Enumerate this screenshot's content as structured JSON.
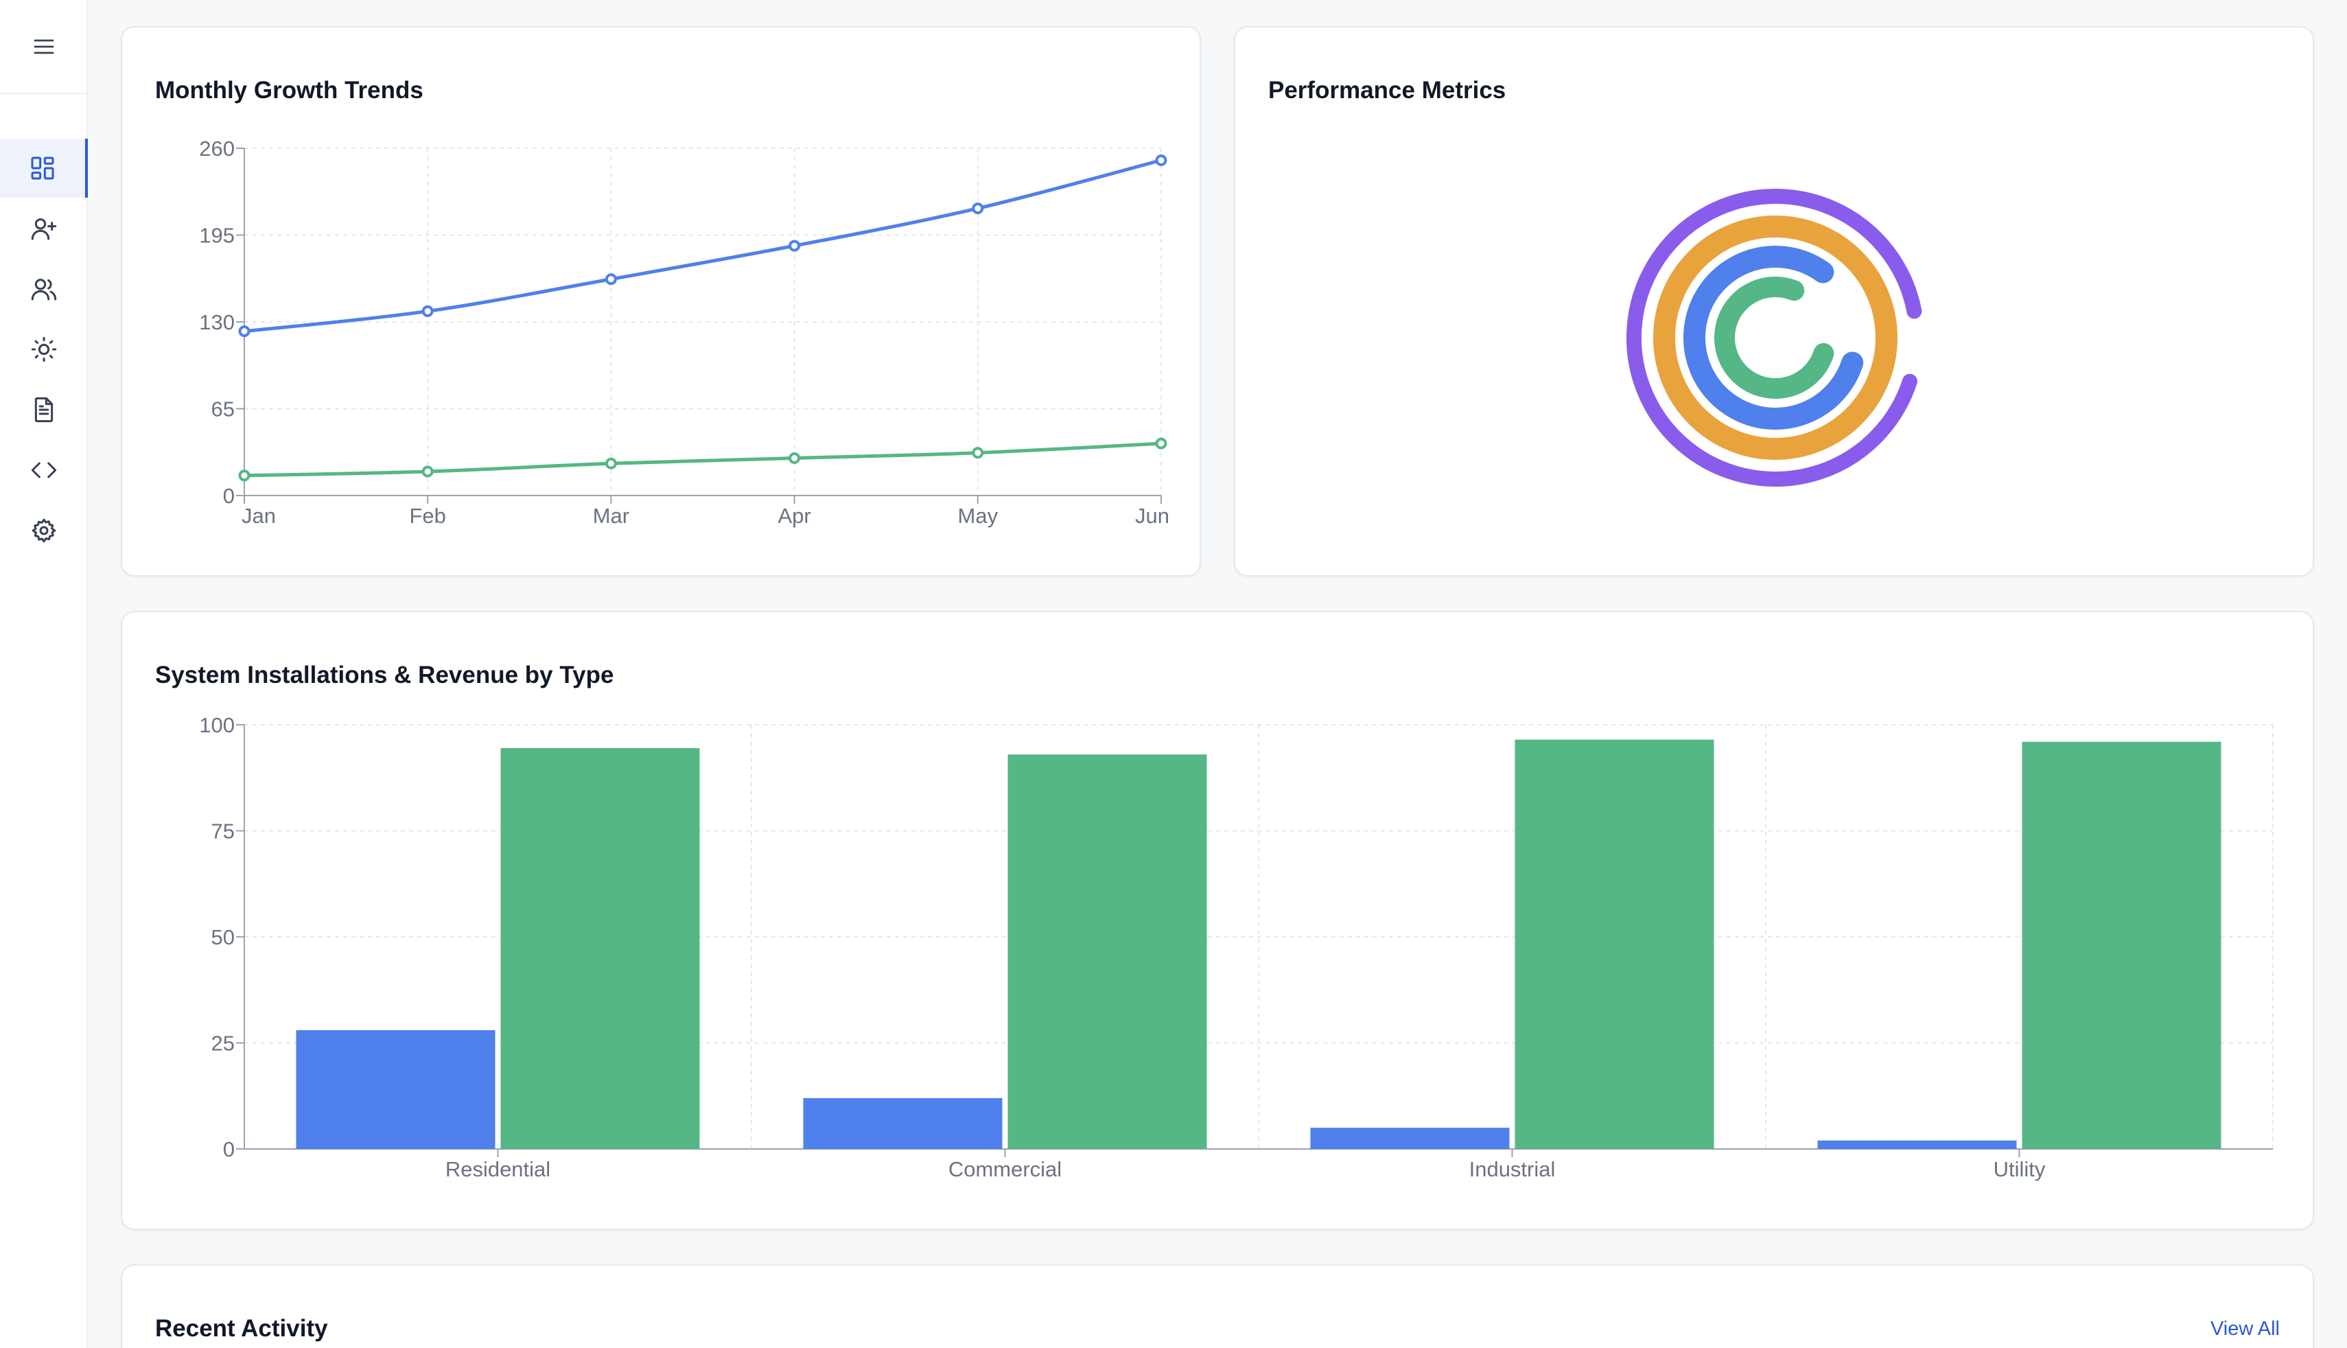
{
  "sidebar": {
    "menu_icon": "hamburger-icon",
    "items": [
      {
        "name": "dashboard",
        "icon": "dashboard-grid-icon",
        "active": true
      },
      {
        "name": "add-user",
        "icon": "user-plus-icon",
        "active": false
      },
      {
        "name": "users",
        "icon": "users-icon",
        "active": false
      },
      {
        "name": "solar",
        "icon": "sun-icon",
        "active": false
      },
      {
        "name": "documents",
        "icon": "document-icon",
        "active": false
      },
      {
        "name": "code",
        "icon": "code-icon",
        "active": false
      },
      {
        "name": "settings",
        "icon": "gear-icon",
        "active": false
      }
    ]
  },
  "cards": {
    "growth": {
      "title": "Monthly Growth Trends"
    },
    "performance": {
      "title": "Performance Metrics"
    },
    "installs": {
      "title": "System Installations & Revenue by Type"
    },
    "activity": {
      "title": "Recent Activity",
      "link": "View All"
    }
  },
  "colors": {
    "blue": "#4f80ec",
    "green": "#55b785",
    "orange": "#e8a33d",
    "purple": "#8a5cec",
    "accent": "#2b59d6"
  },
  "chart_data": [
    {
      "type": "line",
      "title": "Monthly Growth Trends",
      "x": [
        "Jan",
        "Feb",
        "Mar",
        "Apr",
        "May",
        "Jun"
      ],
      "ylim": [
        0,
        260
      ],
      "yticks": [
        0,
        65,
        130,
        195,
        260
      ],
      "grid": true,
      "series": [
        {
          "values": [
            123,
            138,
            162,
            187,
            215,
            251
          ],
          "color": "#4f80ec"
        },
        {
          "values": [
            15,
            18,
            24,
            28,
            32,
            39
          ],
          "color": "#55b785"
        }
      ]
    },
    {
      "type": "radial-bar",
      "title": "Performance Metrics",
      "ylim": [
        0,
        100
      ],
      "series": [
        {
          "values": [
            92
          ],
          "color": "#8a5cec"
        },
        {
          "values": [
            100
          ],
          "color": "#e8a33d"
        },
        {
          "values": [
            80
          ],
          "color": "#4f80ec"
        },
        {
          "values": [
            76
          ],
          "color": "#55b785"
        }
      ]
    },
    {
      "type": "bar",
      "title": "System Installations & Revenue by Type",
      "categories": [
        "Residential",
        "Commercial",
        "Industrial",
        "Utility"
      ],
      "ylim": [
        0,
        100
      ],
      "yticks": [
        0,
        25,
        50,
        75,
        100
      ],
      "grid": true,
      "series": [
        {
          "values": [
            28,
            12,
            5,
            2
          ],
          "color": "#4f80ec"
        },
        {
          "values": [
            94.5,
            93,
            96.5,
            96
          ],
          "color": "#55b785"
        }
      ]
    }
  ]
}
